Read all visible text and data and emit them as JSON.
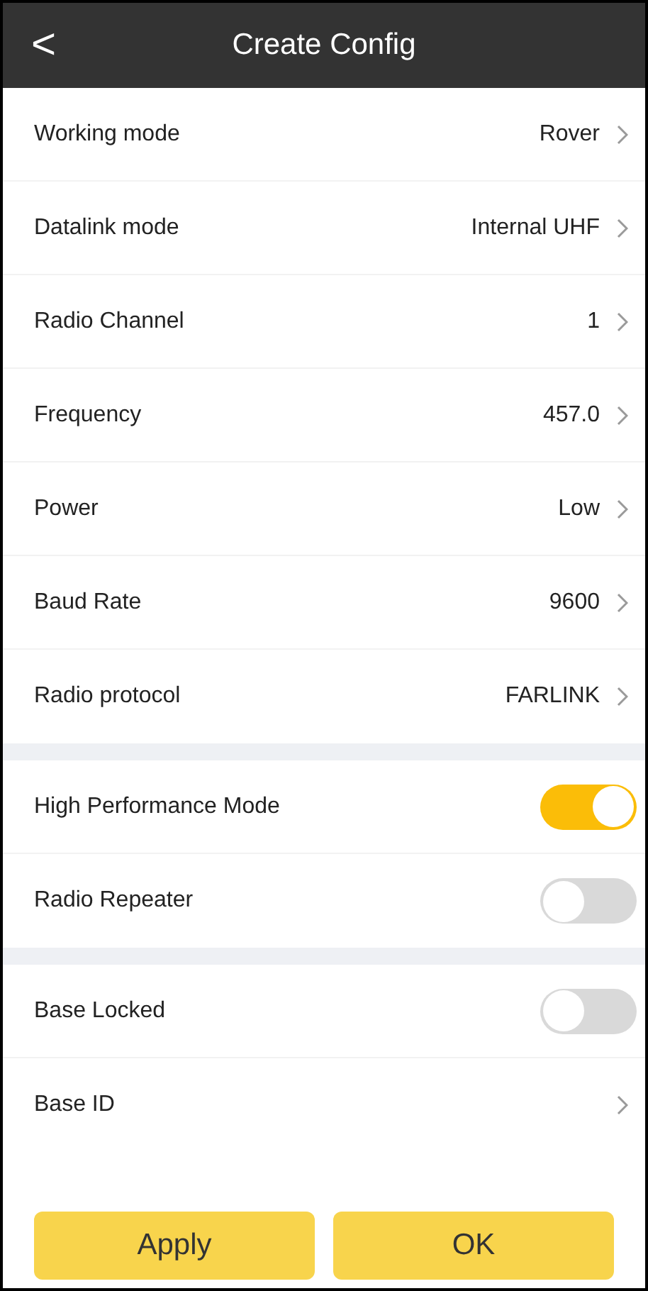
{
  "header": {
    "back": "<",
    "title": "Create Config"
  },
  "sections": [
    {
      "items": [
        {
          "kind": "value",
          "label": "Working mode",
          "value": "Rover"
        },
        {
          "kind": "value",
          "label": "Datalink mode",
          "value": "Internal UHF"
        },
        {
          "kind": "value",
          "label": "Radio Channel",
          "value": "1"
        },
        {
          "kind": "value",
          "label": "Frequency",
          "value": "457.0"
        },
        {
          "kind": "value",
          "label": "Power",
          "value": "Low"
        },
        {
          "kind": "value",
          "label": "Baud Rate",
          "value": "9600"
        },
        {
          "kind": "value",
          "label": "Radio protocol",
          "value": "FARLINK"
        }
      ]
    },
    {
      "items": [
        {
          "kind": "toggle",
          "label": "High Performance Mode",
          "on": true
        },
        {
          "kind": "toggle",
          "label": "Radio Repeater",
          "on": false
        }
      ]
    },
    {
      "items": [
        {
          "kind": "toggle",
          "label": "Base Locked",
          "on": false
        },
        {
          "kind": "value",
          "label": "Base ID"
        }
      ]
    }
  ],
  "buttons": [
    "Apply",
    "OK"
  ]
}
